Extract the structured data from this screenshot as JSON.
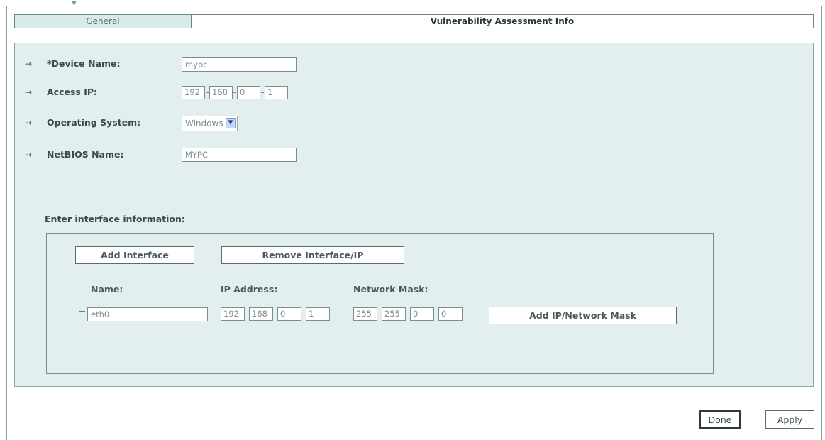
{
  "tabs": {
    "general": "General",
    "vulnerability": "Vulnerability Assessment Info"
  },
  "fields": {
    "device_name": {
      "label": "*Device Name:",
      "value": "mypc"
    },
    "access_ip": {
      "label": "Access IP:",
      "octets": [
        "192",
        "168",
        "0",
        "1"
      ]
    },
    "operating_system": {
      "label": "Operating System:",
      "value": "Windows"
    },
    "netbios_name": {
      "label": "NetBIOS Name:",
      "value": "MYPC"
    }
  },
  "interface_section": {
    "title": "Enter interface information:",
    "add_interface": "Add Interface",
    "remove_interface": "Remove Interface/IP",
    "columns": {
      "name": "Name:",
      "ip": "IP Address:",
      "mask": "Network Mask:"
    },
    "rows": [
      {
        "checked": false,
        "name": "eth0",
        "ip": [
          "192",
          "168",
          "0",
          "1"
        ],
        "mask": [
          "255",
          "255",
          "0",
          "0"
        ],
        "add_ip_label": "Add IP/Network Mask"
      }
    ]
  },
  "footer": {
    "done": "Done",
    "apply": "Apply"
  },
  "icons": {
    "row_arrow": "→",
    "dropdown": "chevron-down-icon"
  },
  "colors": {
    "panel_bg": "#e3efef",
    "active_tab_bg": "#d9eaea"
  }
}
